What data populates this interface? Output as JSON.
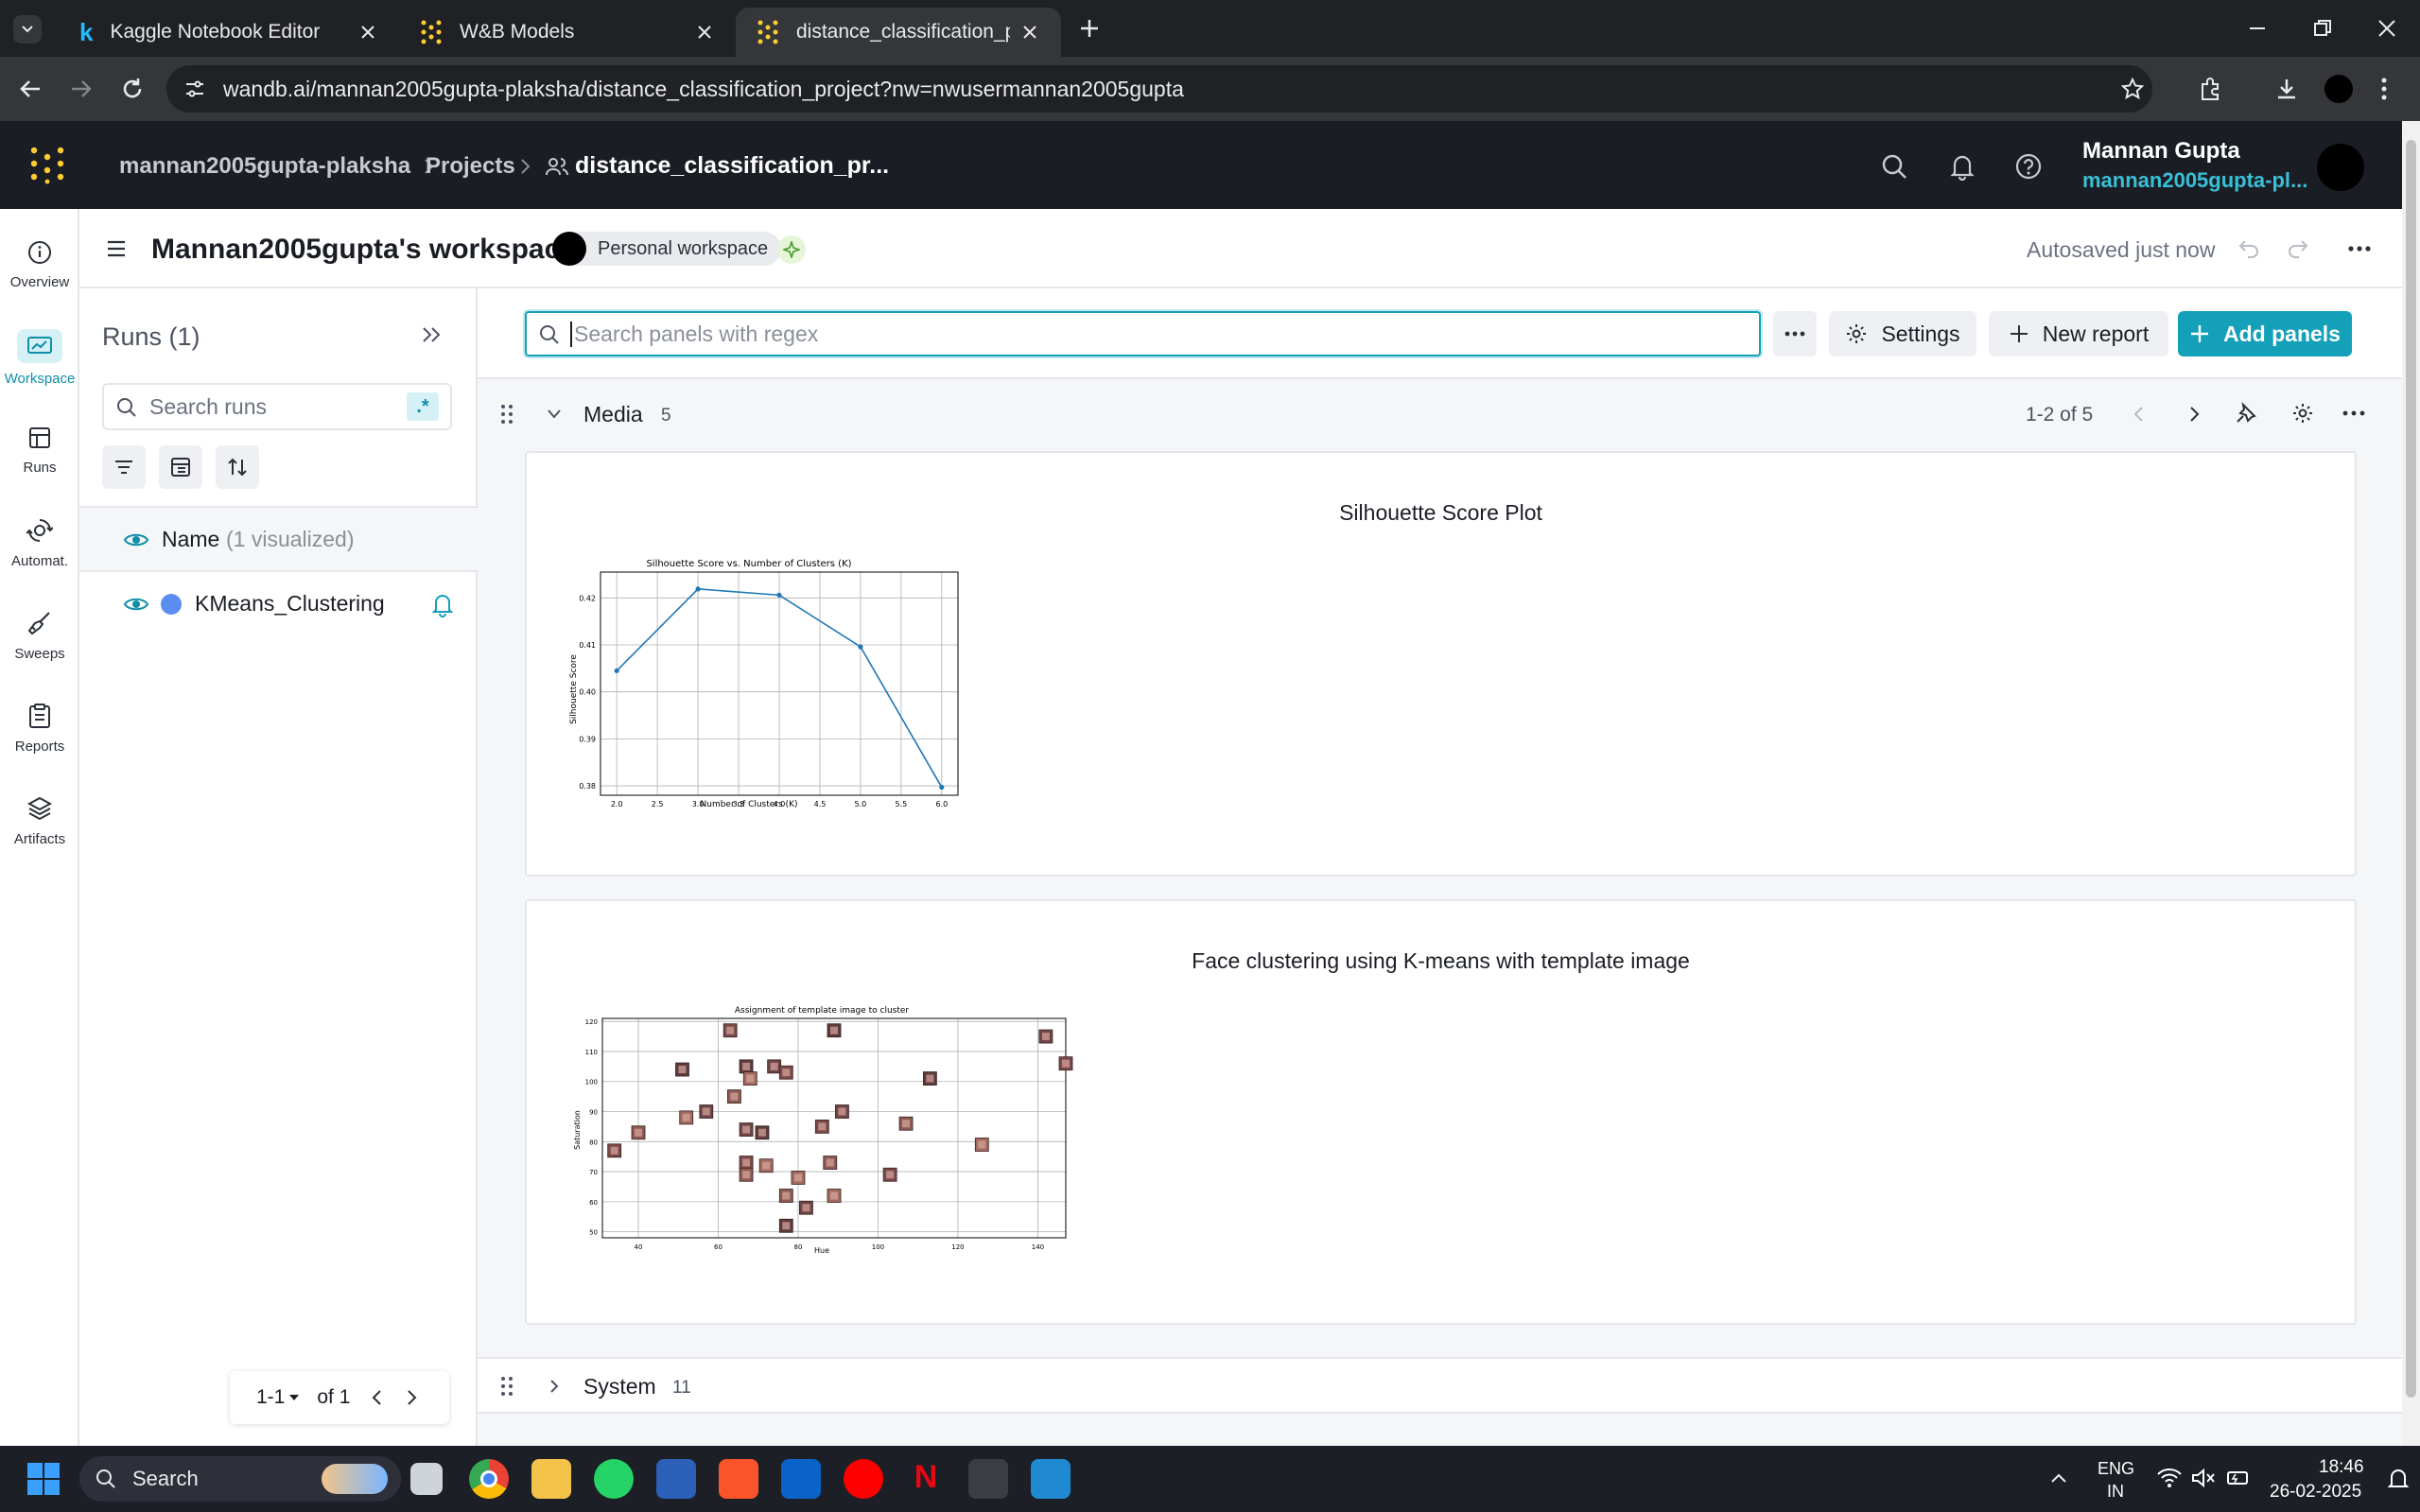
{
  "browser": {
    "tabs": [
      {
        "title": "Kaggle Notebook Editor",
        "icon": "kaggle-k-icon"
      },
      {
        "title": "W&B Models",
        "icon": "wandb-dots-icon"
      },
      {
        "title": "distance_classification_project │",
        "icon": "wandb-dots-icon"
      }
    ],
    "url": "wandb.ai/mannan2005gupta-plaksha/distance_classification_project?nw=nwusermannan2005gupta"
  },
  "header": {
    "breadcrumb_entity": "mannan2005gupta-plaksha",
    "breadcrumb_projects": "Projects",
    "breadcrumb_project": "distance_classification_pr...",
    "user_name": "Mannan Gupta",
    "user_entity": "mannan2005gupta-pl..."
  },
  "rail": {
    "items": [
      {
        "label": "Overview",
        "icon": "info-icon"
      },
      {
        "label": "Workspace",
        "icon": "workspace-icon"
      },
      {
        "label": "Runs",
        "icon": "table-icon"
      },
      {
        "label": "Automat.",
        "icon": "automation-icon"
      },
      {
        "label": "Sweeps",
        "icon": "broom-icon"
      },
      {
        "label": "Reports",
        "icon": "clipboard-icon"
      },
      {
        "label": "Artifacts",
        "icon": "layers-icon"
      }
    ]
  },
  "workspace": {
    "title": "Mannan2005gupta's workspace",
    "badge": "Personal workspace",
    "autosave": "Autosaved just now"
  },
  "runs": {
    "title": "Runs (1)",
    "search_placeholder": "Search runs",
    "regex_label": ".*",
    "name_header": "Name",
    "visualized": "(1 visualized)",
    "items": [
      {
        "name": "KMeans_Clustering",
        "color": "#5b8def"
      }
    ],
    "pagination_range": "1-1",
    "pagination_of": "of 1"
  },
  "main": {
    "search_placeholder": "Search panels with regex",
    "settings_label": "Settings",
    "new_report_label": "New report",
    "add_panels_label": "Add panels",
    "sections": [
      {
        "name": "Media",
        "count": "5",
        "pager": "1-2 of 5"
      },
      {
        "name": "System",
        "count": "11"
      }
    ],
    "panels": [
      {
        "title": "Silhouette Score Plot"
      },
      {
        "title": "Face clustering using K-means with template image"
      }
    ]
  },
  "accent_color": "#13a0b8",
  "taskbar": {
    "search_label": "Search",
    "lang_top": "ENG",
    "lang_bottom": "IN",
    "time": "18:46",
    "date": "26-02-2025"
  },
  "chart_data": [
    {
      "type": "line",
      "title": "Silhouette Score vs. Number of Clusters (K)",
      "xlabel": "Number of Clusters (K)",
      "ylabel": "Silhouette Score",
      "x": [
        2,
        3,
        4,
        5,
        6
      ],
      "y": [
        0.4045,
        0.4219,
        0.4206,
        0.4096,
        0.3797
      ],
      "xticks": [
        "2.0",
        "2.5",
        "3.0",
        "3.5",
        "4.0",
        "4.5",
        "5.0",
        "5.5",
        "6.0"
      ],
      "yticks": [
        "0.38",
        "0.39",
        "0.40",
        "0.41",
        "0.42"
      ],
      "xlim": [
        1.8,
        6.2
      ],
      "ylim": [
        0.378,
        0.4255
      ],
      "grid": true,
      "color": "#1f77b4"
    },
    {
      "type": "scatter",
      "title": "Assignment of template image to cluster",
      "xlabel": "Hue",
      "ylabel": "Saturation",
      "xticks": [
        "40",
        "60",
        "80",
        "100",
        "120",
        "140"
      ],
      "yticks": [
        "50",
        "60",
        "70",
        "80",
        "90",
        "100",
        "110",
        "120"
      ],
      "xlim": [
        31,
        147
      ],
      "ylim": [
        48,
        121
      ],
      "grid": true,
      "points": [
        {
          "x": 34,
          "y": 77
        },
        {
          "x": 40,
          "y": 83
        },
        {
          "x": 51,
          "y": 104
        },
        {
          "x": 52,
          "y": 88
        },
        {
          "x": 57,
          "y": 90
        },
        {
          "x": 63,
          "y": 117
        },
        {
          "x": 64,
          "y": 95
        },
        {
          "x": 67,
          "y": 105
        },
        {
          "x": 68,
          "y": 101
        },
        {
          "x": 67,
          "y": 84
        },
        {
          "x": 67,
          "y": 73
        },
        {
          "x": 67,
          "y": 69
        },
        {
          "x": 71,
          "y": 83
        },
        {
          "x": 72,
          "y": 72
        },
        {
          "x": 74,
          "y": 105
        },
        {
          "x": 77,
          "y": 103
        },
        {
          "x": 77,
          "y": 62
        },
        {
          "x": 77,
          "y": 52
        },
        {
          "x": 80,
          "y": 68
        },
        {
          "x": 82,
          "y": 58
        },
        {
          "x": 86,
          "y": 85
        },
        {
          "x": 88,
          "y": 73
        },
        {
          "x": 89,
          "y": 117
        },
        {
          "x": 89,
          "y": 62
        },
        {
          "x": 91,
          "y": 90
        },
        {
          "x": 103,
          "y": 69
        },
        {
          "x": 107,
          "y": 86
        },
        {
          "x": 113,
          "y": 101
        },
        {
          "x": 126,
          "y": 79
        },
        {
          "x": 142,
          "y": 115
        },
        {
          "x": 147,
          "y": 106
        }
      ]
    }
  ]
}
